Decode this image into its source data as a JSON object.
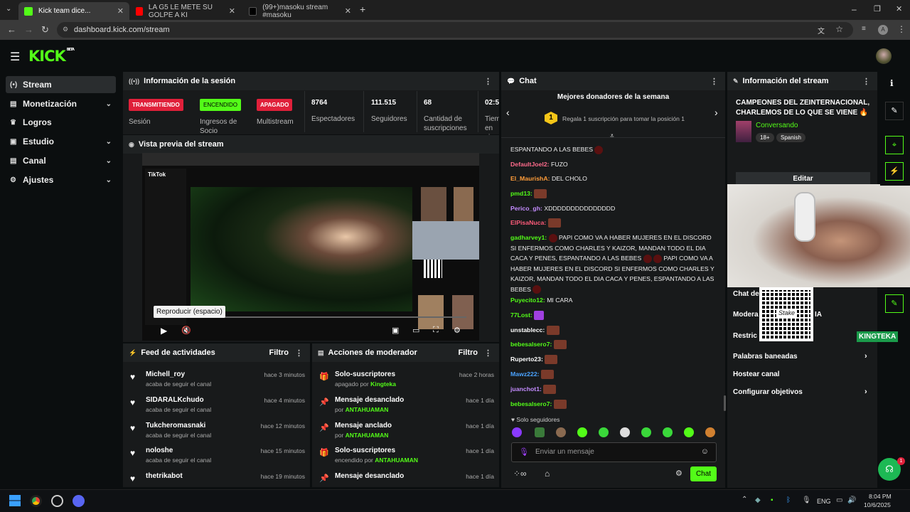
{
  "browser": {
    "tabs": [
      {
        "title": "Kick team dice...",
        "color": "#53fc18"
      },
      {
        "title": "LA G5 LE METE SU GOLPE A KI",
        "color": "#ff0000"
      },
      {
        "title": "(99+)masoku stream #masoku",
        "color": "#111111"
      }
    ],
    "url": "dashboard.kick.com/stream",
    "profile_initial": "A"
  },
  "header": {
    "logo": "KICK",
    "logo_badge": "BETA"
  },
  "sidebar": {
    "items": [
      {
        "label": "Stream",
        "icon": "(•)",
        "active": true
      },
      {
        "label": "Monetización",
        "icon": "▣"
      },
      {
        "label": "Logros",
        "icon": "🏆"
      },
      {
        "label": "Estudio",
        "icon": "▣"
      },
      {
        "label": "Canal",
        "icon": "▣"
      },
      {
        "label": "Ajustes",
        "icon": "⚙"
      }
    ]
  },
  "session": {
    "title": "Información de la sesión",
    "badges": [
      {
        "text": "TRANSMITIENDO",
        "label": "Sesión",
        "color": "#e0203a"
      },
      {
        "text": "ENCENDIDO",
        "label": "Ingresos de Socio",
        "color": "#53fc18"
      },
      {
        "text": "APAGADO",
        "label": "Multistream",
        "color": "#e0203a"
      }
    ],
    "stats": [
      {
        "value": "8764",
        "label": "Espectadores"
      },
      {
        "value": "111.515",
        "label": "Seguidores"
      },
      {
        "value": "68",
        "label": "Cantidad de suscripciones"
      },
      {
        "value": "02:5",
        "label": "Tiem en vi"
      }
    ]
  },
  "preview": {
    "title": "Vista previa del stream",
    "tooltip": "Reproducir (espacio)",
    "inner_app": "TikTok"
  },
  "feed": {
    "title": "Feed de actividades",
    "filter": "Filtro",
    "items": [
      {
        "name": "Michell_roy",
        "sub": "acaba de seguir el canal",
        "time": "hace 3 minutos"
      },
      {
        "name": "SIDARALKchudo",
        "sub": "acaba de seguir el canal",
        "time": "hace 4 minutos"
      },
      {
        "name": "Tukcheromasnaki",
        "sub": "acaba de seguir el canal",
        "time": "hace 12 minutos"
      },
      {
        "name": "noloshe",
        "sub": "acaba de seguir el canal",
        "time": "hace 15 minutos"
      },
      {
        "name": "thetrikabot",
        "sub": "",
        "time": "hace 19 minutos"
      }
    ]
  },
  "modactions": {
    "title": "Acciones de moderador",
    "filter": "Filtro",
    "items": [
      {
        "name": "Solo-suscriptores",
        "sub": "apagado por ",
        "who": "Kingteka",
        "time": "hace 2 horas",
        "icon": "🎁"
      },
      {
        "name": "Mensaje desanclado",
        "sub": "por ",
        "who": "ANTAHUAMAN",
        "time": "hace 1 día",
        "icon": "📌"
      },
      {
        "name": "Mensaje anclado",
        "sub": "por ",
        "who": "ANTAHUAMAN",
        "time": "hace 1 día",
        "icon": "📌"
      },
      {
        "name": "Solo-suscriptores",
        "sub": "encendido por ",
        "who": "ANTAHUAMAN",
        "time": "hace 1 día",
        "icon": "🎁"
      },
      {
        "name": "Mensaje desanclado",
        "sub": "",
        "who": "",
        "time": "hace 1 día",
        "icon": "📌"
      }
    ]
  },
  "chat": {
    "title": "Chat",
    "donors_title": "Mejores donadores de la semana",
    "donors_rank": "1",
    "donors_text": "Regala 1 suscripción para tomar la posición 1",
    "messages": [
      {
        "user": "",
        "text": "ESPANTANDO A LAS BEBES",
        "color": "#ffffff"
      },
      {
        "user": "DefaultJoel2:",
        "text": "FUZO",
        "color": "#ff9d3a"
      },
      {
        "user": "El_MaurishA:",
        "text": "DEL CHOLO",
        "color": "#ff9d3a"
      },
      {
        "user": "pmd13:",
        "text": "",
        "color": "#53fc18"
      },
      {
        "user": "Perico_gh:",
        "text": "XDDDDDDDDDDDDDDD",
        "color": "#c48cff"
      },
      {
        "user": "ElPisaNuca:",
        "text": "",
        "color": "#ff5b7a"
      },
      {
        "user": "gadharvey1:",
        "text": "PAPI COMO VA A HABER MUJERES EN EL DISCORD SI ENFERMOS COMO CHARLES Y KAIZOR, MANDAN TODO EL DIA CACA Y PENES, ESPANTANDO A LAS BEBES",
        "text2": "PAPI COMO VA A HABER MUJERES EN EL DISCORD SI ENFERMOS COMO CHARLES Y KAIZOR, MANDAN TODO EL DIA CACA Y PENES, ESPANTANDO A LAS BEBES",
        "color": "#53fc18"
      },
      {
        "user": "Puyecito12:",
        "text": "MI CARA",
        "color": "#53fc18"
      },
      {
        "user": "77Lost:",
        "text": "",
        "color": "#53fc18"
      },
      {
        "user": "unstablecc:",
        "text": "",
        "color": "#ffffff"
      },
      {
        "user": "bebesalsero7:",
        "text": "",
        "color": "#53fc18"
      },
      {
        "user": "Ruperto23:",
        "text": "",
        "color": "#ffffff"
      },
      {
        "user": "Mawz222:",
        "text": "",
        "color": "#4aa3ff"
      },
      {
        "user": "juanchot1:",
        "text": "",
        "color": "#c48cff"
      },
      {
        "user": "bebesalsero7:",
        "text": "",
        "color": "#53fc18"
      }
    ],
    "followers_only": "Solo seguidores",
    "input_placeholder": "Enviar un mensaje",
    "send_label": "Chat"
  },
  "streaminfo": {
    "title": "Información del stream",
    "stream_title": "CAMPEONES DEL ZEINTERNACIONAL, CHARLEMOS DE LO QUE SE VIENE 🔥",
    "category": "Conversando",
    "tags": [
      "18+",
      "Spanish"
    ],
    "edit": "Editar",
    "rows": [
      "Chat de",
      "Modera",
      "Restric",
      "Palabras baneadas",
      "Hostear canal",
      "Configurar objetivos"
    ],
    "rows_right": [
      "IA"
    ],
    "overlay_brand": "Stake",
    "overlay_name": "KINGTEKA"
  },
  "taskbar": {
    "lang": "ENG",
    "time": "8:04 PM",
    "date": "10/6/2025"
  },
  "colors": {
    "accent": "#53fc18",
    "bg": "#0b0e0f",
    "panel": "#181a1b"
  }
}
